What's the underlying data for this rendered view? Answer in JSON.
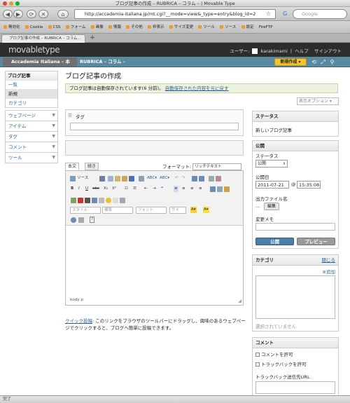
{
  "browser": {
    "window_title": "ブログ記事の作成 – RUBRICA – コラム – | Movable Type",
    "url": "http://accademia-italiana.jp/mt.cgi?__mode=view&_type=entry&blog_id=2",
    "search_placeholder": "Google",
    "tab_title": "ブログ記事の作成 – RUBRICA – コラム...",
    "status_text": "完了",
    "bookmarks": [
      "無効化",
      "Cookie",
      "CSS",
      "フォーム",
      "画像",
      "情報",
      "その他",
      "枠表示",
      "サイズ変更",
      "ツール",
      "ソース",
      "設定"
    ],
    "firebug": "FireFTP"
  },
  "mt": {
    "logo_main": "movable",
    "logo_sub": "type",
    "user_label": "ユーザー:",
    "username": "karakimami",
    "help": "ヘルプ",
    "signout": "サインアウト",
    "blog_selector": "Accademia Italiana – 本",
    "blog_current": "RUBRICA – コラム –",
    "new_button": "新規作成"
  },
  "sidebar": {
    "title": "ブログ記事",
    "items": [
      "一覧",
      "新規",
      "カテゴリ"
    ],
    "sections": [
      "ウェブページ",
      "アイテム",
      "タグ",
      "コメント",
      "ツール"
    ]
  },
  "main": {
    "page_title": "ブログ記事の作成",
    "notice_text": "ブログ記事は自動保存されています(6 分前)。",
    "notice_link": "自動保存された内容を元に戻す",
    "display_options": "表示オプション",
    "tag_label": "タグ",
    "editor_tabs": [
      "本文",
      "続き"
    ],
    "format_label": "フォーマット:",
    "format_value": "リッチテキスト",
    "toolbar_source": "ソース",
    "style_placeholder": "スタイル",
    "heading_placeholder": "標準",
    "font_placeholder": "フォント",
    "size_placeholder": "サイ",
    "statusbar_path": "body  p",
    "quickpost_link": "クイック投稿",
    "quickpost_text": ": このリンクをブラウザのツールバーにドラッグし、興味のあるウェブページでクリックすると、ブログへ簡単に投稿できます。"
  },
  "status_panel": {
    "title": "ステータス",
    "value": "新しいブログ記事"
  },
  "publish_panel": {
    "title": "公開",
    "status_label": "ステータス",
    "status_value": "公開",
    "date_label": "公開日",
    "date_value": "2011-07-21",
    "at": "@",
    "time_value": "15:35:08",
    "outfile_label": "出力ファイル名",
    "outfile_value": "...",
    "edit_button": "編集",
    "change_note_label": "変更メモ",
    "publish_button": "公開",
    "preview_button": "プレビュー"
  },
  "category_panel": {
    "title": "カテゴリ",
    "close": "閉じる",
    "add": "追加",
    "empty": "選択されていません"
  },
  "comment_panel": {
    "title": "コメント",
    "allow_comments": "コメントを許可",
    "allow_trackbacks": "トラックバックを許可",
    "trackback_url": "トラックバック送信先URL"
  },
  "colors": {
    "mt_header": "#2d2d2d",
    "mt_nav": "#5a8aa0",
    "new_button": "#f4c430",
    "publish_button": "#4a7ea8",
    "link": "#2a6496"
  }
}
